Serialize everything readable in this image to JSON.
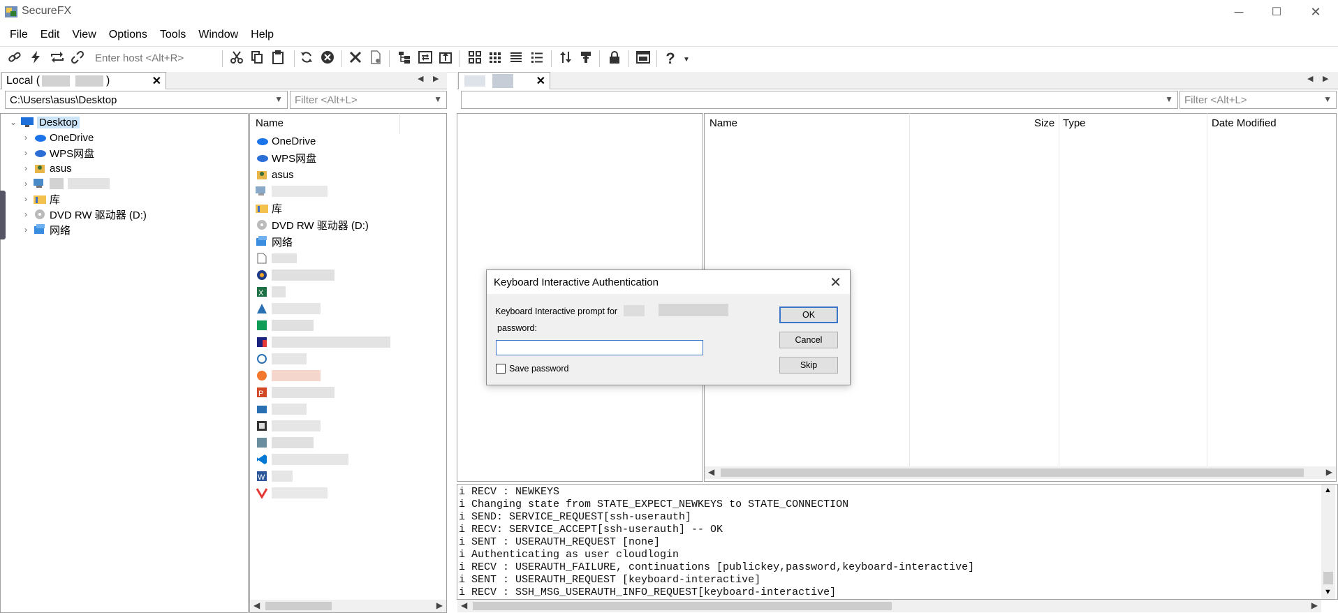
{
  "window": {
    "title": "SecureFX",
    "min_glyph": "─",
    "max_glyph": "☐",
    "close_glyph": "✕"
  },
  "menu": [
    "File",
    "Edit",
    "View",
    "Options",
    "Tools",
    "Window",
    "Help"
  ],
  "toolbar": {
    "host_placeholder": "Enter host <Alt+R>"
  },
  "local": {
    "tab_label": "Local (",
    "tab_label_end": ")",
    "path": "C:\\Users\\asus\\Desktop",
    "filter_placeholder": "Filter <Alt+L>",
    "tree": [
      {
        "label": "Desktop",
        "icon": "desktop-icon",
        "selected": true
      },
      {
        "label": "OneDrive",
        "icon": "cloud-icon"
      },
      {
        "label": "WPS网盘",
        "icon": "cloud-icon"
      },
      {
        "label": "asus",
        "icon": "user-folder-icon"
      },
      {
        "label": "",
        "icon": "computer-icon"
      },
      {
        "label": "库",
        "icon": "library-folder-icon"
      },
      {
        "label": "DVD RW 驱动器 (D:)",
        "icon": "dvd-drive-icon"
      },
      {
        "label": "网络",
        "icon": "network-icon"
      }
    ],
    "list_header": "Name",
    "list": [
      {
        "label": "OneDrive",
        "icon": "cloud-icon"
      },
      {
        "label": "WPS网盘",
        "icon": "cloud-icon"
      },
      {
        "label": "asus",
        "icon": "user-folder-icon"
      },
      {
        "label": "",
        "icon": "computer-icon"
      },
      {
        "label": "库",
        "icon": "library-folder-icon"
      },
      {
        "label": "DVD RW 驱动器 (D:)",
        "icon": "dvd-drive-icon"
      },
      {
        "label": "网络",
        "icon": "network-icon"
      }
    ]
  },
  "remote": {
    "filter_placeholder": "Filter <Alt+L>",
    "columns": [
      "Name",
      "Size",
      "Type",
      "Date Modified"
    ]
  },
  "log": [
    "i RECV : NEWKEYS",
    "i Changing state from STATE_EXPECT_NEWKEYS to STATE_CONNECTION",
    "i SEND: SERVICE_REQUEST[ssh-userauth]",
    "i RECV: SERVICE_ACCEPT[ssh-userauth] -- OK",
    "i SENT : USERAUTH_REQUEST [none]",
    "i Authenticating as user cloudlogin",
    "i RECV : USERAUTH_FAILURE, continuations [publickey,password,keyboard-interactive]",
    "i SENT : USERAUTH_REQUEST [keyboard-interactive]",
    "i RECV : SSH_MSG_USERAUTH_INFO_REQUEST[keyboard-interactive]"
  ],
  "dialog": {
    "title": "Keyboard Interactive Authentication",
    "prompt": "Keyboard Interactive prompt for",
    "field_label": "password:",
    "password_value": "",
    "save_password_label": "Save password",
    "save_password_checked": false,
    "ok_label": "OK",
    "cancel_label": "Cancel",
    "skip_label": "Skip"
  },
  "colors": {
    "accent": "#3b75c8",
    "selection": "#cce4f7"
  }
}
